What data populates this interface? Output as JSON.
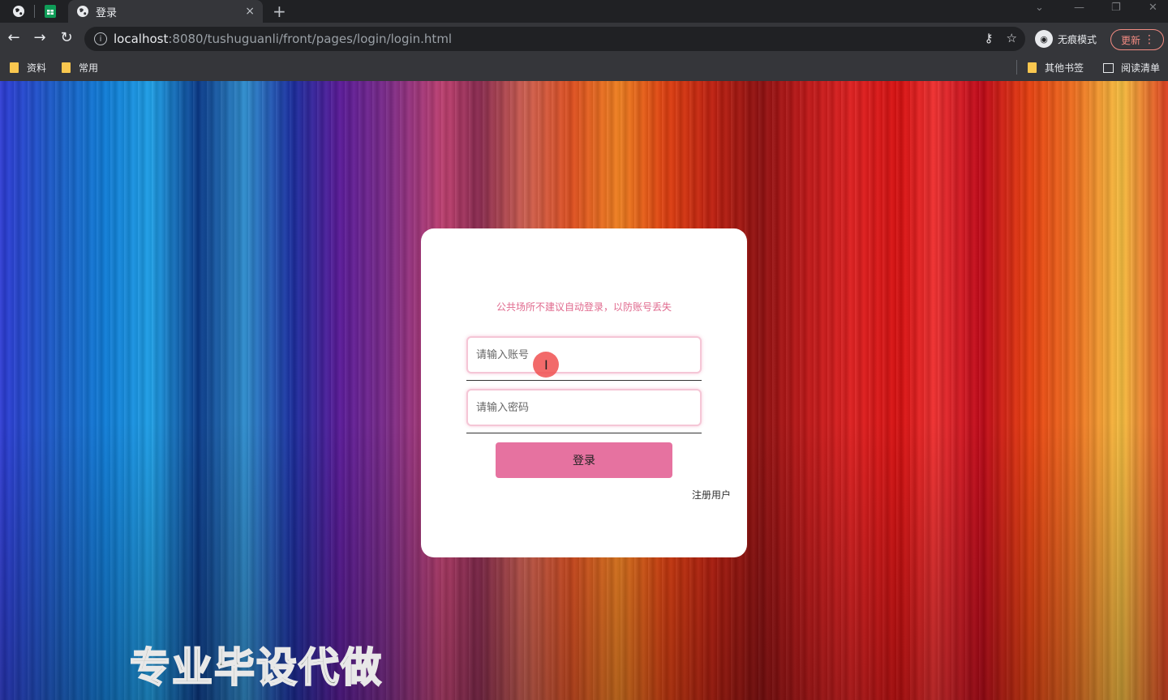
{
  "browser": {
    "tab_title": "登录",
    "tab_close": "×",
    "new_tab": "+",
    "url_host": "localhost",
    "url_path": ":8080/tushuguanli/front/pages/login/login.html",
    "incognito_label": "无痕模式",
    "update_label": "更新",
    "bookmarks": [
      "资料",
      "常用"
    ],
    "other_bookmarks": "其他书签",
    "reading_list": "阅读清单"
  },
  "login": {
    "notice": "公共场所不建议自动登录，以防账号丢失",
    "account_placeholder": "请输入账号",
    "password_placeholder": "请输入密码",
    "submit_label": "登录",
    "register_link": "注册用户"
  },
  "overlay": {
    "watermark": "专业毕设代做"
  },
  "colors": {
    "accent": "#e672a0",
    "notice": "#e06a8e"
  }
}
